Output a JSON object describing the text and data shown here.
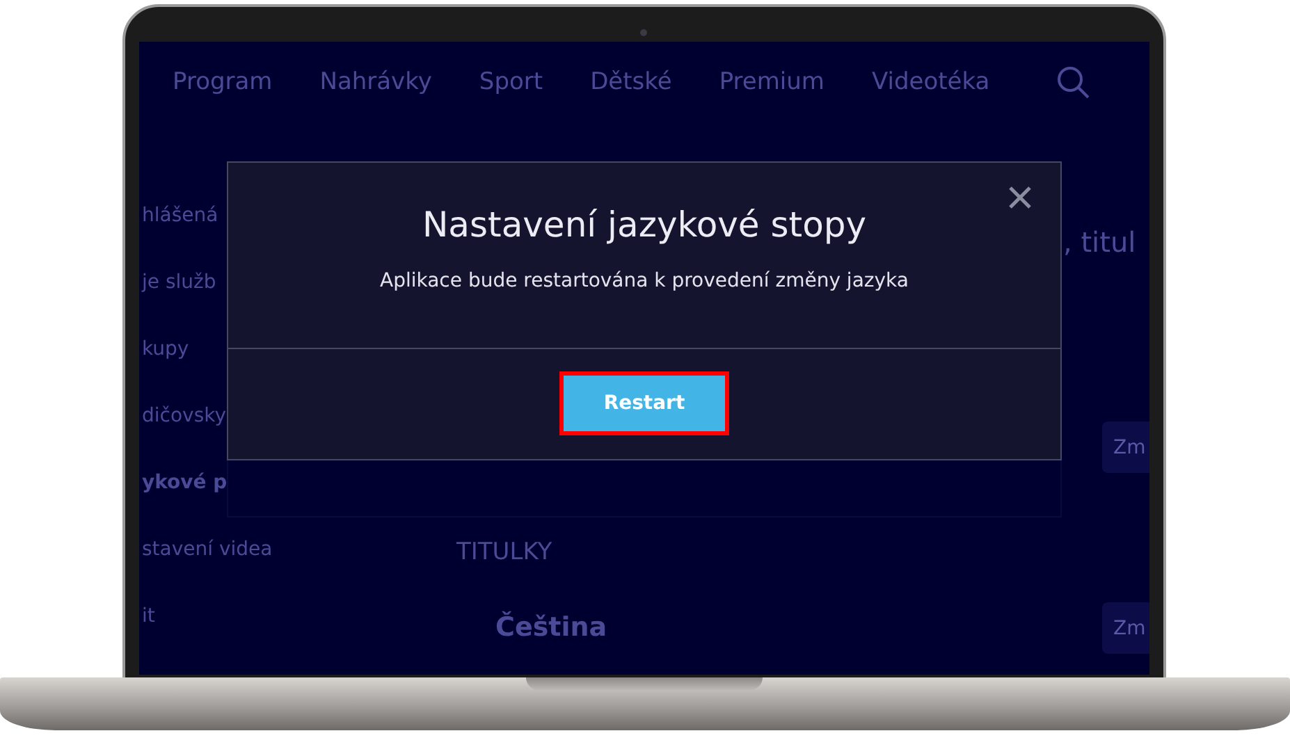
{
  "nav": {
    "items": [
      {
        "label": "Program"
      },
      {
        "label": "Nahrávky"
      },
      {
        "label": "Sport"
      },
      {
        "label": "Dětské"
      },
      {
        "label": "Premium"
      },
      {
        "label": "Videotéka"
      }
    ]
  },
  "sidebar": {
    "items": [
      {
        "label": "hlášená",
        "bold": false
      },
      {
        "label": "je služb",
        "bold": false
      },
      {
        "label": "kupy",
        "bold": false
      },
      {
        "label": "dičovsky",
        "bold": false
      },
      {
        "label": "ykové p",
        "bold": true
      },
      {
        "label": "stavení videa",
        "bold": false
      },
      {
        "label": "it",
        "bold": false
      }
    ]
  },
  "content": {
    "subtitle_fragment": ", titul",
    "section_label": "TITULKY",
    "language": "Čeština",
    "buttons": [
      "Zm",
      "Zm"
    ]
  },
  "dialog": {
    "title": "Nastavení jazykové stopy",
    "message": "Aplikace bude restartována k provedení změny jazyka",
    "button": "Restart",
    "button_highlighted": true
  }
}
